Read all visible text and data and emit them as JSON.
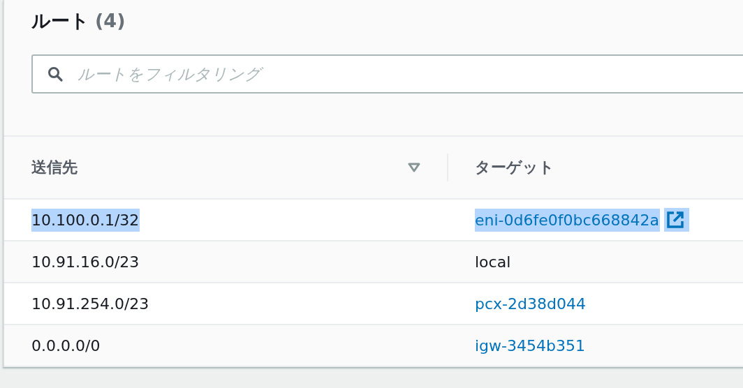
{
  "header": {
    "title": "ルート",
    "count": "(4)"
  },
  "search": {
    "placeholder": "ルートをフィルタリング"
  },
  "table": {
    "columns": [
      {
        "label": "送信先",
        "sorted": true
      },
      {
        "label": "ターゲット",
        "sorted": false
      }
    ],
    "rows": [
      {
        "destination": "10.100.0.1/32",
        "target": "eni-0d6fe0f0bc668842a",
        "kind": "link",
        "external": true,
        "highlighted": true
      },
      {
        "destination": "10.91.16.0/23",
        "target": "local",
        "kind": "text",
        "external": false,
        "highlighted": false
      },
      {
        "destination": "10.91.254.0/23",
        "target": "pcx-2d38d044",
        "kind": "link",
        "external": false,
        "highlighted": false
      },
      {
        "destination": "0.0.0.0/0",
        "target": "igw-3454b351",
        "kind": "link",
        "external": false,
        "highlighted": false
      }
    ]
  }
}
